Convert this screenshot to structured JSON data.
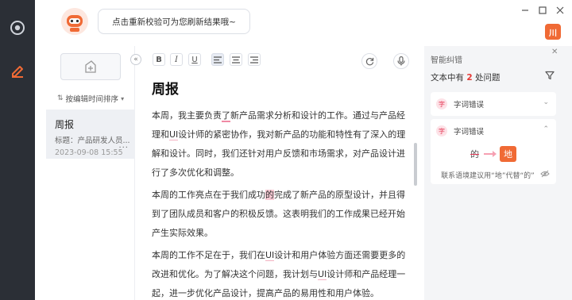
{
  "top": {
    "hint": "点击重新校验可为您刷新结果哦~",
    "badge_text": "川"
  },
  "sidebar": {
    "sort_label": "按编辑时间排序",
    "doc": {
      "title": "周报",
      "subtitle": "标题：产品研发人员...",
      "date": "2023-09-08 15:55",
      "more": "···"
    }
  },
  "toolbar": {
    "bold": "B",
    "italic": "I",
    "underline": "U"
  },
  "editor": {
    "title": "周报",
    "p1": {
      "a": "本周，我主要负责",
      "err": "了",
      "b": "新产品需求分析和设计的工作。通过与产品经理和",
      "ui": "UI",
      "c": "设计师的紧密协作，我对新产品的功能和特性有了深入的理解和设计。同时，我们还针对用户反馈和市场需求，对产品设计进行了多次优化和调整。"
    },
    "p2": {
      "a": "本周的工作亮点在于我们成功",
      "err": "的",
      "b": "完成了新产品的原型设计，并且得到了团队成员和客户的积极反馈。这表明我们的工作成果已经开始产生实际效果。"
    },
    "p3": {
      "a": "本周的工作不足在于，我们在",
      "ui1": "UI",
      "b": "设计和用户体验方面还需要更多的改进和优化。为了解决这个问题，我计划与",
      "ui2": "UI",
      "c": "设计师和产品经理一起，进一步优化产品设计，提高产品的易用性和用户体验。"
    }
  },
  "panel": {
    "title": "智能纠错",
    "count_prefix": "文本中有",
    "count": "2",
    "count_suffix": "处问题",
    "cards": [
      {
        "tag": "字",
        "label": "字词错误",
        "expanded": false
      },
      {
        "tag": "字",
        "label": "字词错误",
        "expanded": true,
        "wrong": "的",
        "right": "地",
        "suggestion": "联系语境建议用“地”代替“的”"
      }
    ]
  },
  "colors": {
    "rail": "#2b2f36",
    "accent": "#f06a35",
    "error": "#e53935"
  }
}
